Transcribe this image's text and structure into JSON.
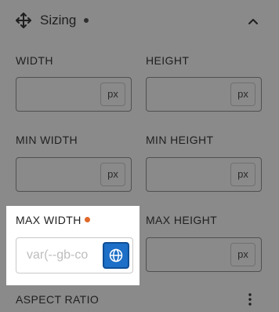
{
  "section": {
    "title": "Sizing",
    "icons": {
      "move": "move-icon",
      "collapse": "chevron-up-icon"
    }
  },
  "fields": {
    "width": {
      "label": "WIDTH",
      "unit": "px"
    },
    "height": {
      "label": "HEIGHT",
      "unit": "px"
    },
    "min_width": {
      "label": "MIN WIDTH",
      "unit": "px"
    },
    "min_height": {
      "label": "MIN HEIGHT",
      "unit": "px"
    },
    "max_width": {
      "label": "MAX WIDTH",
      "placeholder": "var(--gb-co",
      "indicator_color": "#e0682a",
      "button_icon": "globe-icon"
    },
    "max_height": {
      "label": "MAX HEIGHT",
      "unit": "px"
    }
  },
  "aspect_ratio": {
    "label": "ASPECT RATIO",
    "icon": "more-vertical-icon"
  },
  "colors": {
    "accent": "#1d6fc7",
    "modified_dot": "#e0682a"
  }
}
